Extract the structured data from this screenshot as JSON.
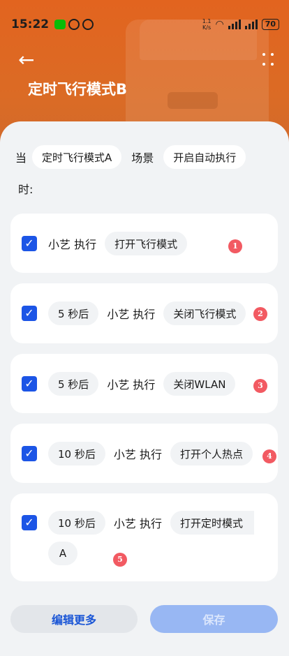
{
  "status": {
    "time": "15:22",
    "speed_top": "1.1",
    "speed_bottom": "K/s",
    "battery": "70"
  },
  "header": {
    "title": "定时飞行模式B"
  },
  "condition": {
    "when_prefix": "当",
    "scene_chip": "定时飞行模式A",
    "scene_label": "场景",
    "action_chip": "开启自动执行",
    "when_suffix": "时:"
  },
  "tasks": [
    {
      "delay": "",
      "actor": "小艺 执行",
      "action": "打开飞行模式",
      "index": "1"
    },
    {
      "delay": "5 秒后",
      "actor": "小艺 执行",
      "action": "关闭飞行模式",
      "index": "2"
    },
    {
      "delay": "5 秒后",
      "actor": "小艺 执行",
      "action": "关闭WLAN",
      "index": "3"
    },
    {
      "delay": "10 秒后",
      "actor": "小艺 执行",
      "action": "打开个人热点",
      "index": "4"
    },
    {
      "delay": "10 秒后",
      "actor": "小艺 执行",
      "action": "打开定时模式",
      "action_cont": "A",
      "index": "5"
    }
  ],
  "footer": {
    "edit_label": "编辑更多",
    "save_label": "保存"
  },
  "colors": {
    "header": "#e2641f",
    "accent": "#1c55e6",
    "badge": "#f25a62"
  }
}
